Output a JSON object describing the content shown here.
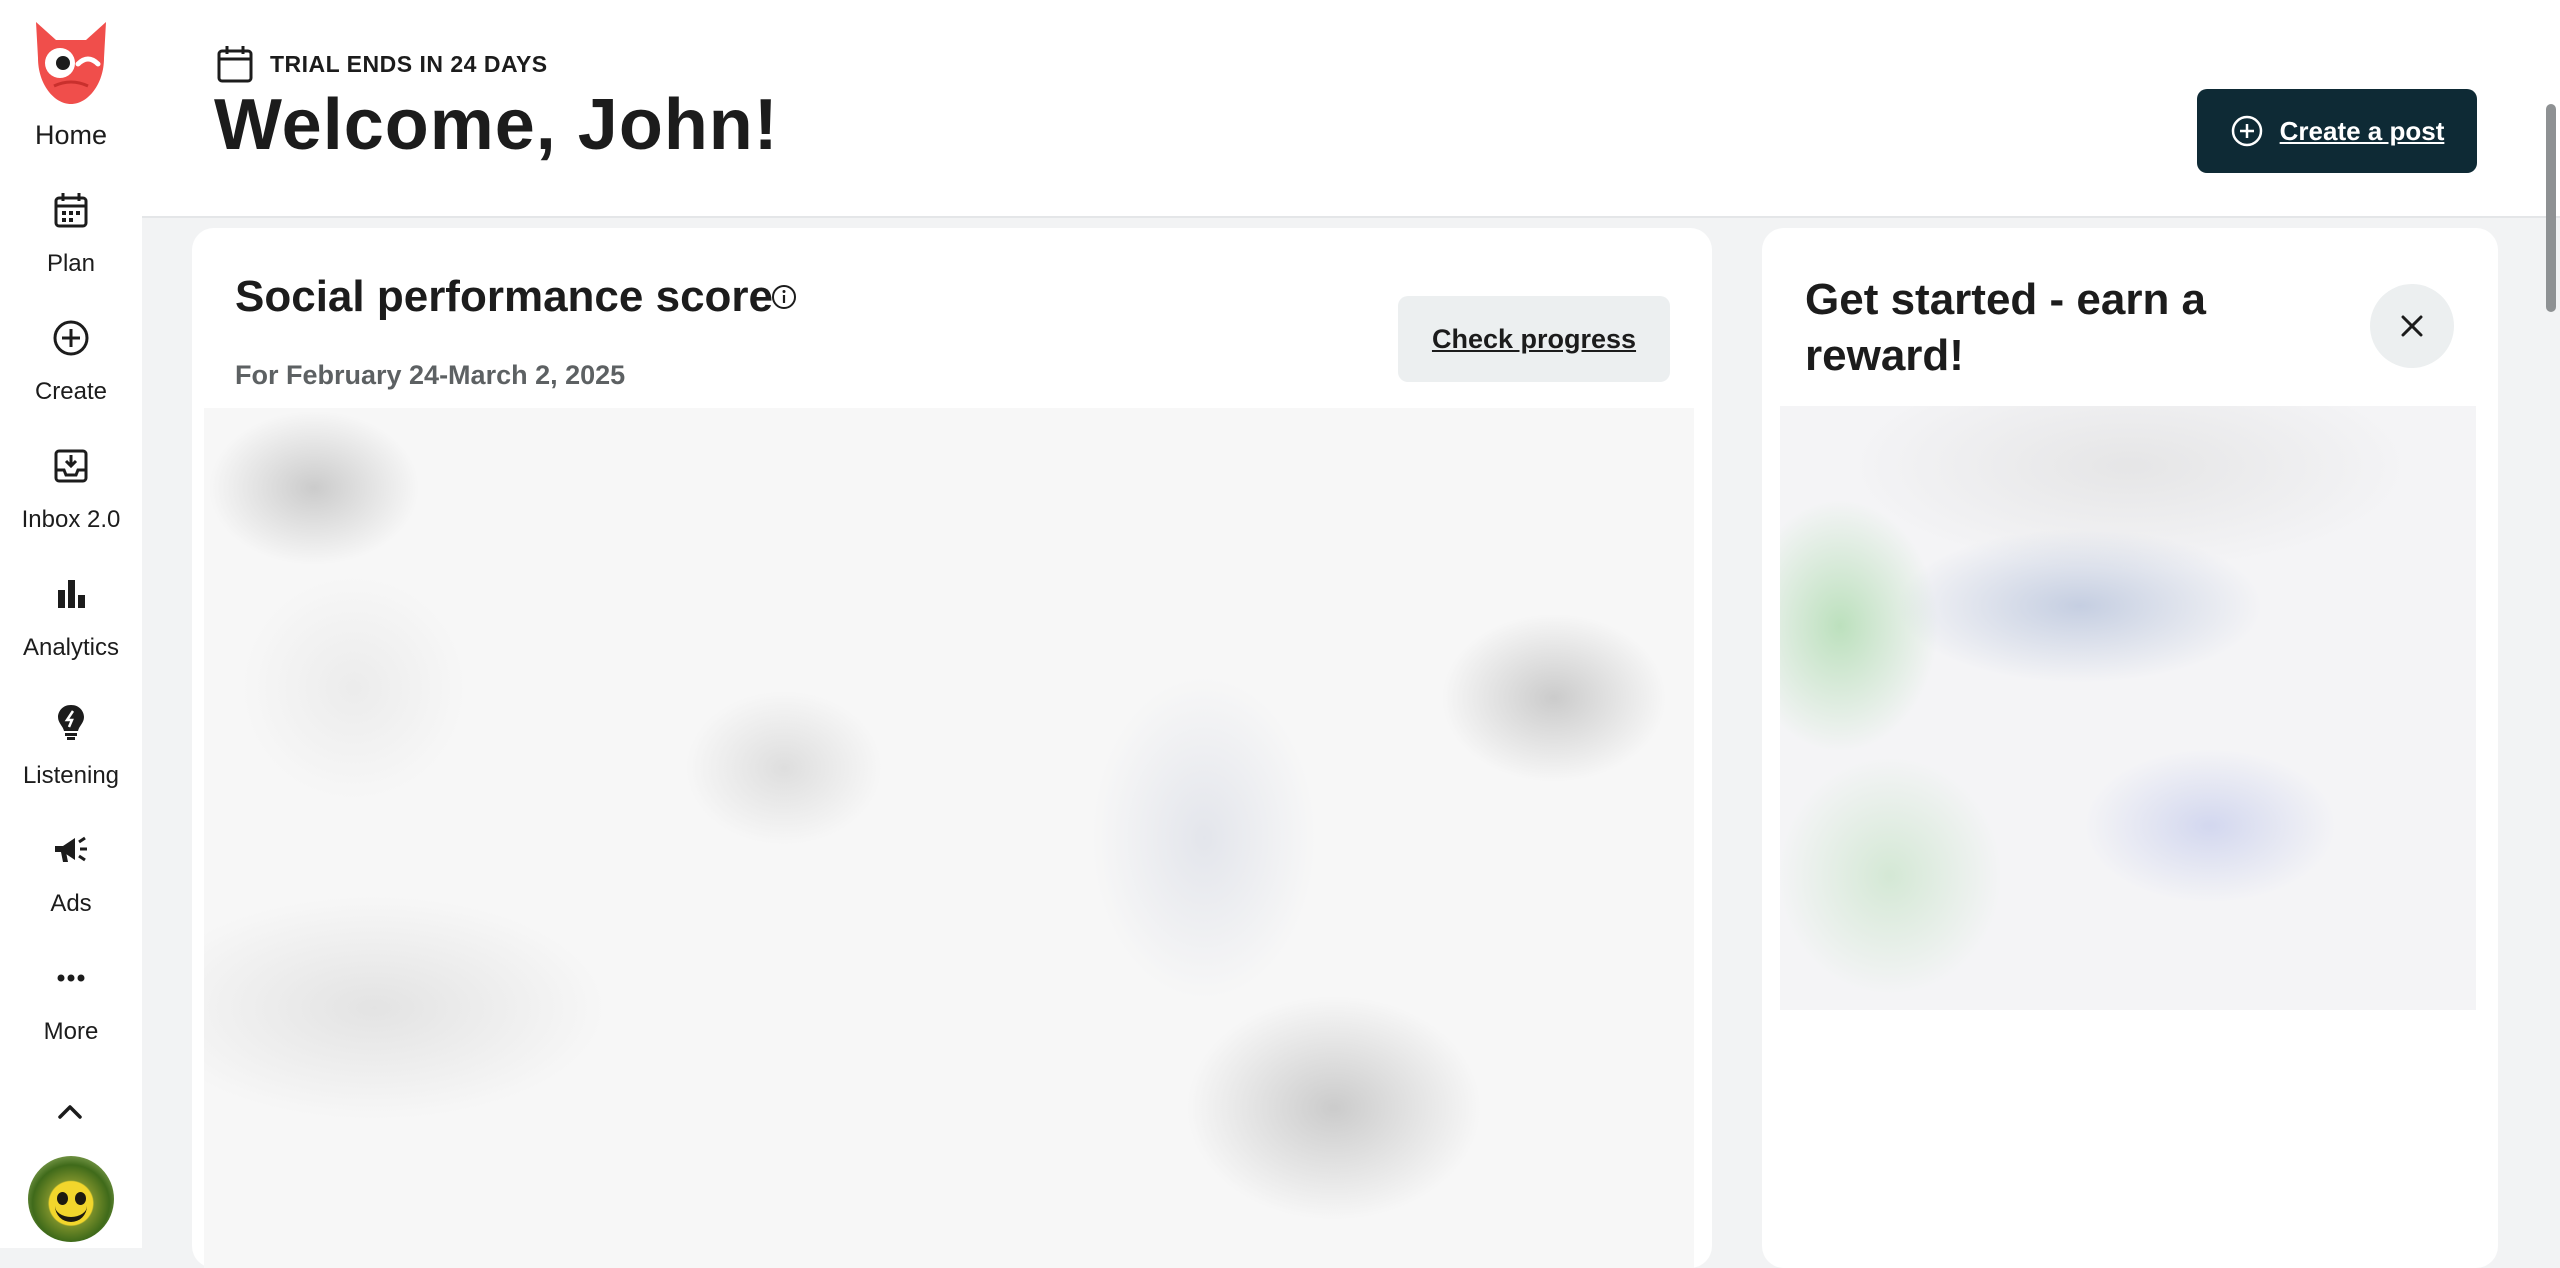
{
  "sidebar": {
    "home_label": "Home",
    "items": [
      {
        "label": "Plan",
        "icon": "calendar-icon"
      },
      {
        "label": "Create",
        "icon": "plus-circle-icon"
      },
      {
        "label": "Inbox 2.0",
        "icon": "inbox-icon"
      },
      {
        "label": "Analytics",
        "icon": "bar-chart-icon"
      },
      {
        "label": "Listening",
        "icon": "lightbulb-icon"
      },
      {
        "label": "Ads",
        "icon": "megaphone-icon"
      },
      {
        "label": "More",
        "icon": "more-dots-icon"
      }
    ]
  },
  "header": {
    "trial_text": "TRIAL ENDS IN 24 DAYS",
    "welcome": "Welcome, John!",
    "create_post_label": "Create a post"
  },
  "score_card": {
    "title": "Social performance score",
    "subtitle": "For February 24-March 2, 2025",
    "check_progress_label": "Check progress"
  },
  "reward_card": {
    "title": "Get started - earn a reward!"
  },
  "colors": {
    "primary_dark": "#0e2a35",
    "brand_red": "#f04e4b",
    "background": "#f2f3f4"
  }
}
